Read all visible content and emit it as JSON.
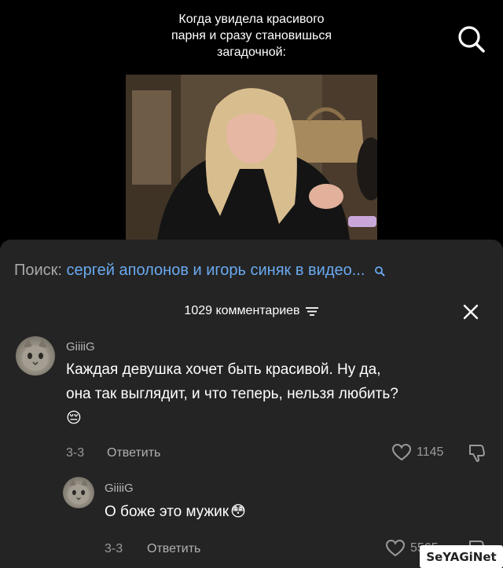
{
  "video": {
    "caption_lines": [
      "Когда увидела красивого",
      "парня и сразу становишься",
      "загадочной:"
    ]
  },
  "search_hint": {
    "label": "Поиск:",
    "query": "сергей аполонов и игорь синяк в видео..."
  },
  "comments_header": {
    "count_label": "1029 комментариев"
  },
  "comments": [
    {
      "username": "GiiiiG",
      "text_lines": [
        "Каждая девушка хочет быть красивой. Ну да,",
        "она так выглядит, и что теперь, нельзя любить?"
      ],
      "emoji": "😔",
      "date": "3-3",
      "reply_label": "Ответить",
      "likes": "1145"
    },
    {
      "username": "GiiiiG",
      "text": "О боже это мужик",
      "emoji": "😳",
      "date": "3-3",
      "reply_label": "Ответить",
      "likes": "5565"
    }
  ],
  "watermark": "SeYAGiNet",
  "colors": {
    "sheet_bg": "#242424",
    "query_blue": "#6aa9ef",
    "muted_text": "#9a9a9a"
  }
}
